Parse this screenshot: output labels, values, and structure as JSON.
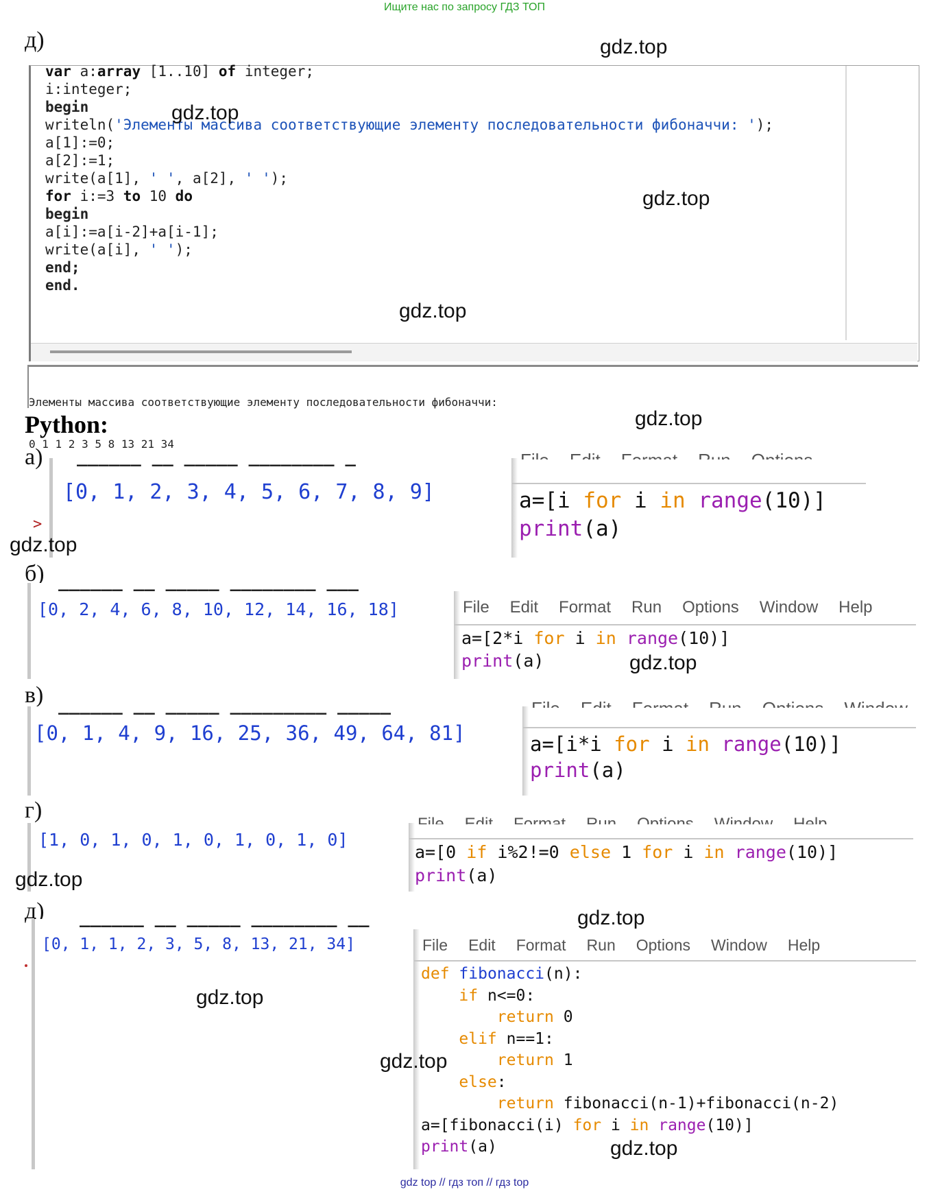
{
  "header": {
    "text": "Ищите нас по запросу ГДЗ ТОП"
  },
  "footer": {
    "text": "gdz top  //  гдз топ  //  гдз top"
  },
  "watermark": "gdz.top",
  "pascal": {
    "letter": "д)",
    "code_lines": [
      "var a:array [1..10] of integer;",
      "i:integer;",
      "begin",
      "writeln('Элементы массива соответствующие элементу последовательности фибоначчи: ');",
      "a[1]:=0;",
      "a[2]:=1;",
      "write(a[1], ' ', a[2], ' ');",
      "for i:=3 to 10 do",
      "begin",
      "a[i]:=a[i-2]+a[i-1];",
      "write(a[i], ' ');",
      "end;",
      "end."
    ],
    "output_lines": [
      "Элементы массива соответствующие элементу последовательности фибоначчи:",
      "0 1 1 2 3 5 8 13 21 34"
    ]
  },
  "python": {
    "heading": "Python:",
    "menu_items": [
      "File",
      "Edit",
      "Format",
      "Run",
      "Options",
      "Window",
      "Help"
    ],
    "tasks": [
      {
        "letter": "а)",
        "output": "[0, 1, 2, 3, 4, 5, 6, 7, 8, 9]",
        "prompt": ">",
        "code": [
          "a=[i for i in range(10)]",
          "print(a)"
        ]
      },
      {
        "letter": "б)",
        "output": "[0, 2, 4, 6, 8, 10, 12, 14, 16, 18]",
        "code": [
          "a=[2*i for i in range(10)]",
          "print(a)"
        ]
      },
      {
        "letter": "в)",
        "output": "[0, 1, 4, 9, 16, 25, 36, 49, 64, 81]",
        "code": [
          "a=[i*i for i in range(10)]",
          "print(a)"
        ]
      },
      {
        "letter": "г)",
        "output": "[1, 0, 1, 0, 1, 0, 1, 0, 1, 0]",
        "code": [
          "a=[0 if i%2!=0 else 1 for i in range(10)]",
          "print(a)"
        ]
      },
      {
        "letter": "д)",
        "output": "[0, 1, 1, 2, 3, 5, 8, 13, 21, 34]",
        "code": [
          "def fibonacci(n):",
          "    if n<=0:",
          "        return 0",
          "    elif n==1:",
          "        return 1",
          "    else:",
          "        return fibonacci(n-1)+fibonacci(n-2)",
          "a=[fibonacci(i) for i in range(10)]",
          "print(a)"
        ]
      }
    ]
  }
}
